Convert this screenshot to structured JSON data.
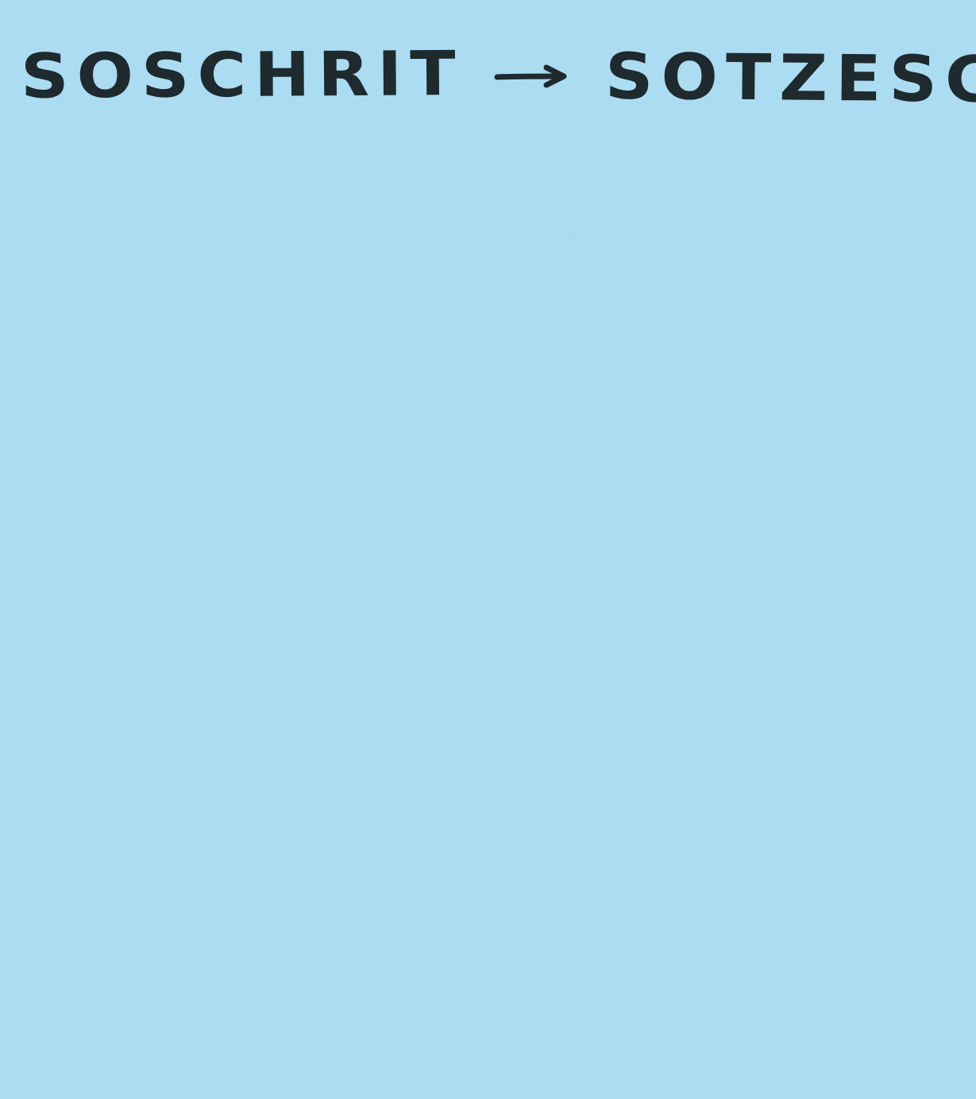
{
  "note": {
    "background_color": "#acdcf2",
    "ink_color": "#1e2a2e",
    "left_word": "SOSCHRIT",
    "arrow_icon": "right-arrow-icon",
    "right_word": "SOTZESCRIT"
  }
}
